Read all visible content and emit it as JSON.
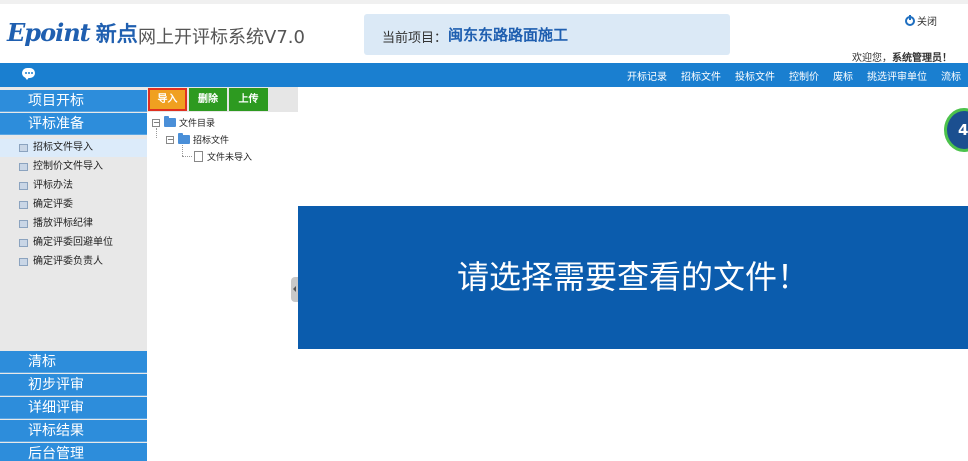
{
  "header": {
    "logo_brand": "Epoint",
    "logo_cn": "新点",
    "system_title": "网上开评标系统V7.0",
    "project_label": "当前项目：",
    "project_name": "闽东东路路面施工",
    "close_label": "关闭",
    "welcome_prefix": "欢迎您，",
    "welcome_user": "系统管理员！"
  },
  "navbar": {
    "items": [
      "开标记录",
      "招标文件",
      "投标文件",
      "控制价",
      "废标",
      "挑选评审单位",
      "流标"
    ]
  },
  "sidebar": {
    "top_sections": [
      "项目开标",
      "评标准备"
    ],
    "items": [
      "招标文件导入",
      "控制价文件导入",
      "评标办法",
      "确定评委",
      "播放评标纪律",
      "确定评委回避单位",
      "确定评委负责人"
    ],
    "active_item": "招标文件导入",
    "bottom_sections": [
      "清标",
      "初步评审",
      "详细评审",
      "评标结果",
      "后台管理"
    ]
  },
  "toolbar": {
    "import_label": "导入",
    "delete_label": "删除",
    "upload_label": "上传"
  },
  "tree": {
    "root": "文件目录",
    "child": "招标文件",
    "leaf": "文件未导入"
  },
  "main": {
    "message": "请选择需要查看的文件！",
    "badge_number": "4"
  },
  "colors": {
    "brand_blue": "#1a7fd0",
    "section_blue": "#2d8ddb",
    "banner_blue": "#0b5cad",
    "import_orange": "#f0a020",
    "action_green": "#2d9a20"
  }
}
